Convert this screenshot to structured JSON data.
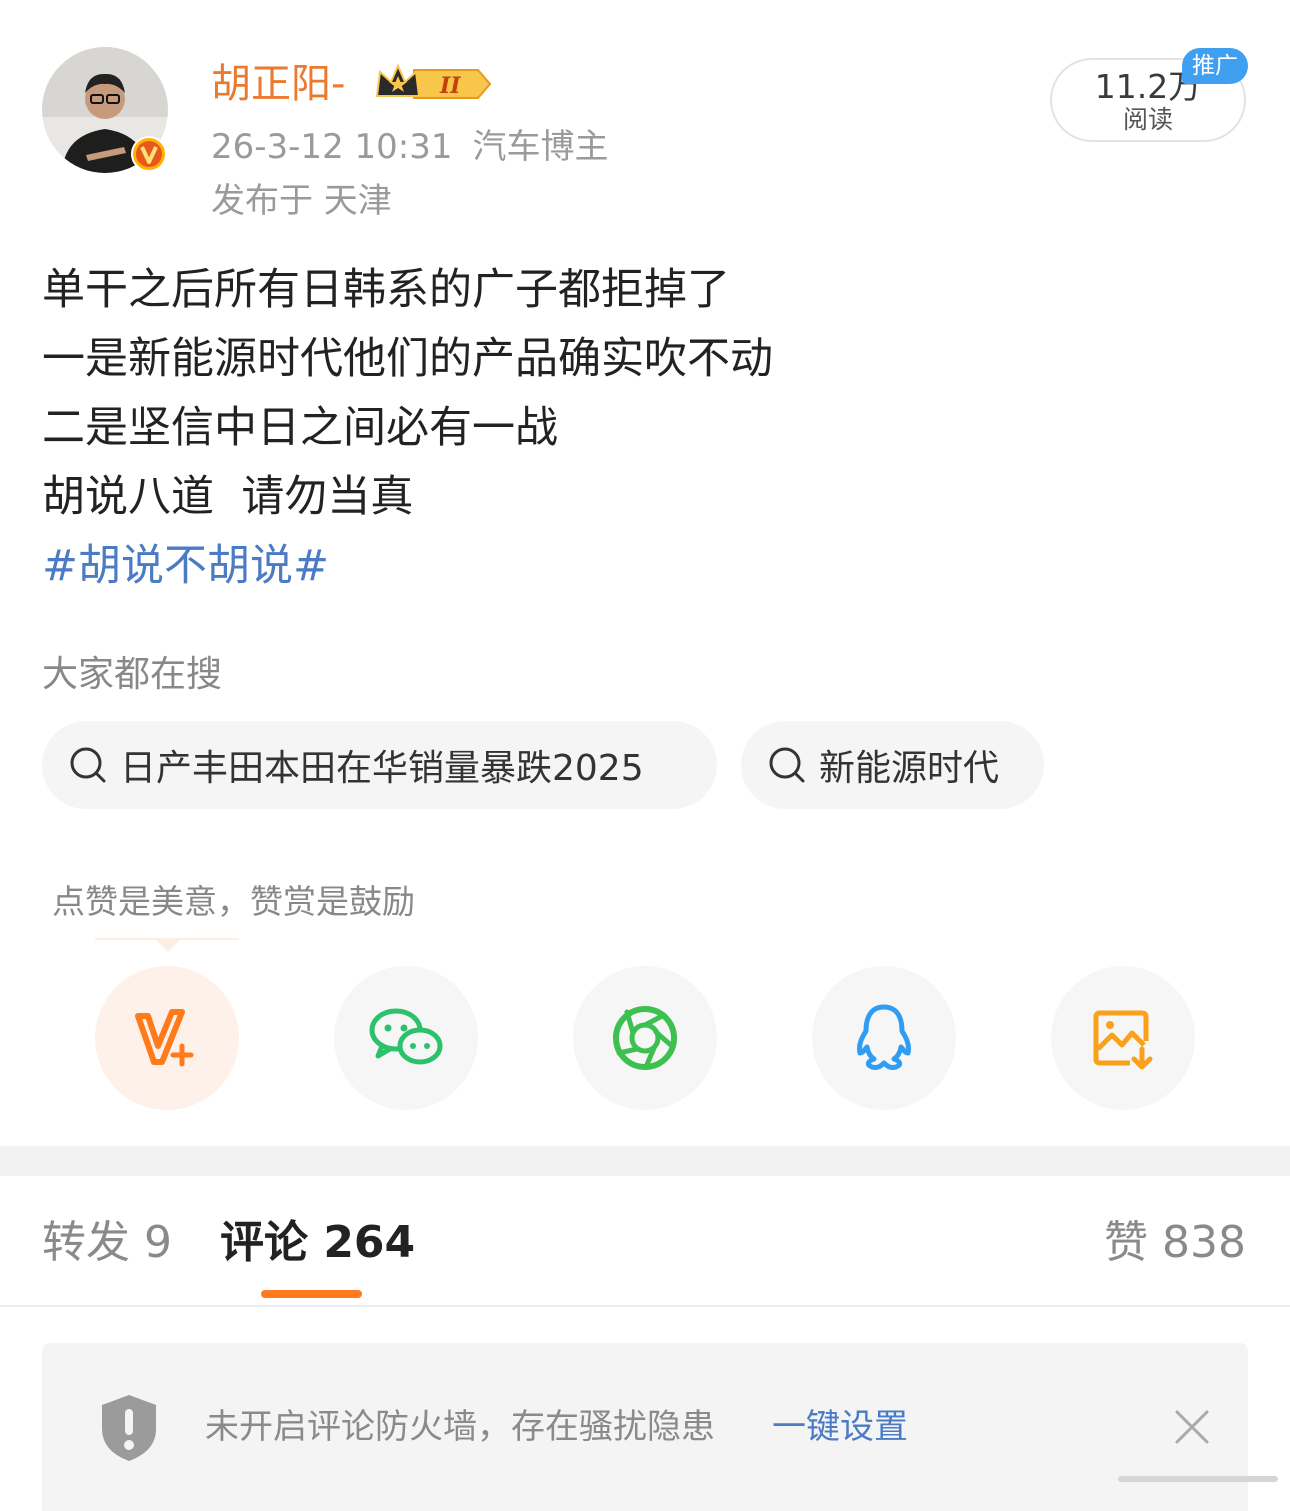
{
  "author": {
    "name": "胡正阳-",
    "level_badge": "II",
    "time": "26-3-12 10:31",
    "source": "汽车博主",
    "location": "发布于 天津",
    "verified_badge": "V"
  },
  "stats": {
    "reads_value": "11.2万",
    "reads_label": "阅读",
    "promo_label": "推广"
  },
  "post": {
    "lines": [
      "单干之后所有日韩系的广子都拒掉了",
      "一是新能源时代他们的产品确实吹不动",
      "二是坚信中日之间必有一战",
      "胡说八道  请勿当真"
    ],
    "hashtag": "#胡说不胡说#"
  },
  "search": {
    "title": "大家都在搜",
    "chips": [
      "日产丰田本田在华销量暴跌2025",
      "新能源时代"
    ]
  },
  "reward": {
    "tip": "点赞是美意，赞赏是鼓励"
  },
  "share_icons": [
    "reward-v-plus-icon",
    "wechat-icon",
    "moments-icon",
    "qq-icon",
    "save-image-icon"
  ],
  "tabs": {
    "repost": "转发 9",
    "comment": "评论 264",
    "like": "赞 838"
  },
  "notice": {
    "text": "未开启评论防火墙，存在骚扰隐患",
    "link": "一键设置"
  },
  "colors": {
    "accent": "#ff7a1a",
    "username": "#ec7a2e",
    "link": "#4b7bc5",
    "promo": "#3f9ff0"
  }
}
